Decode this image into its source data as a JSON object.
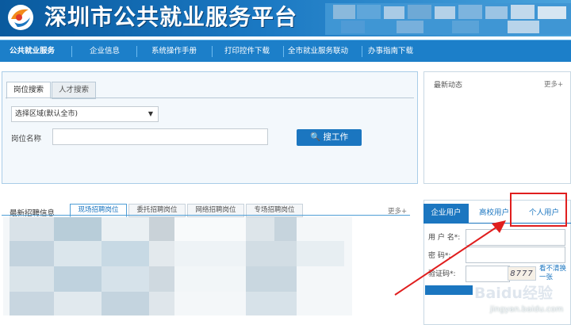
{
  "header": {
    "site_title": "深圳市公共就业服务平台"
  },
  "nav": {
    "items": [
      "公共就业服务",
      "企业信息",
      "系统操作手册",
      "打印控件下载",
      "全市就业服务联动",
      "办事指南下载"
    ]
  },
  "search": {
    "tabs": [
      "岗位搜索",
      "人才搜索"
    ],
    "region_select_value": "选择区域(默认全市)",
    "job_name_label": "岗位名称",
    "job_name_value": "",
    "search_button_label": "搜工作"
  },
  "news": {
    "title": "最新动态",
    "more": "更多+"
  },
  "recruit": {
    "title": "最新招聘信息",
    "tabs": [
      "现场招聘岗位",
      "委托招聘岗位",
      "网络招聘岗位",
      "专场招聘岗位"
    ],
    "more": "更多+"
  },
  "login": {
    "tabs": [
      "企业用户",
      "高校用户",
      "个人用户"
    ],
    "username_label": "用 户 名*:",
    "password_label": "密    码*:",
    "captcha_label": "验证码*:",
    "captcha_text": "8777",
    "captcha_refresh": "看不清换一张"
  },
  "watermark": {
    "logo": "Baidu经验",
    "url": "jingyan.baidu.com"
  },
  "colors": {
    "brand_blue": "#1b76c0",
    "highlight_red": "#e01e1e"
  }
}
